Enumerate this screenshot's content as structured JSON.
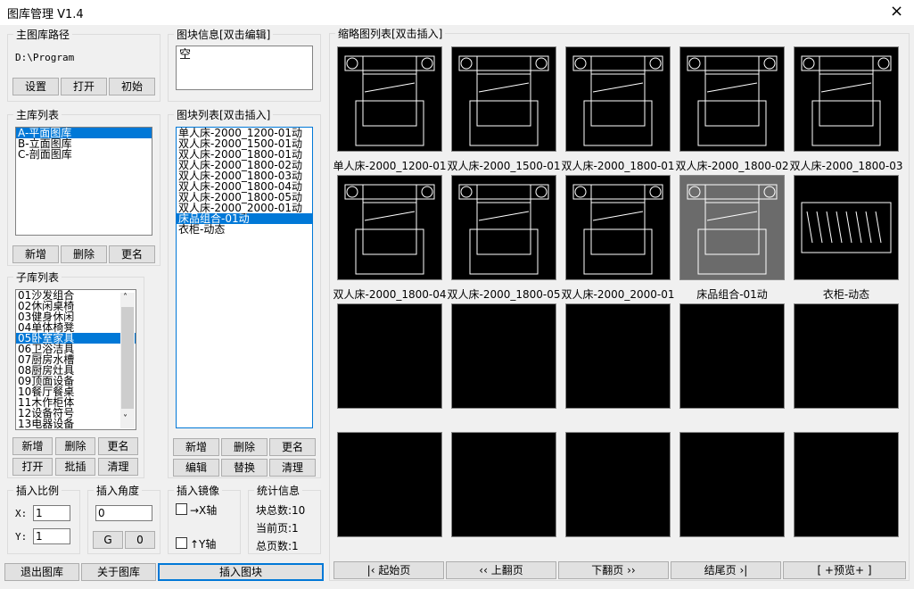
{
  "window": {
    "title": "图库管理 V1.4",
    "close_icon": "×"
  },
  "main_path": {
    "legend": "主图库路径",
    "path": "D:\\Program",
    "buttons": [
      "设置",
      "打开",
      "初始"
    ]
  },
  "block_info": {
    "legend": "图块信息[双击编辑]",
    "value": "空"
  },
  "main_lib": {
    "legend": "主库列表",
    "items": [
      "A-平面图库",
      "B-立面图库",
      "C-剖面图库"
    ],
    "selected": 0,
    "buttons": [
      "新增",
      "删除",
      "更名"
    ]
  },
  "block_list": {
    "legend": "图块列表[双击插入]",
    "items": [
      "单人床-2000_1200-01动",
      "双人床-2000_1500-01动",
      "双人床-2000_1800-01动",
      "双人床-2000_1800-02动",
      "双人床-2000_1800-03动",
      "双人床-2000_1800-04动",
      "双人床-2000_1800-05动",
      "双人床-2000_2000-01动",
      "床品组合-01动",
      "衣柜-动态"
    ],
    "selected": 8,
    "buttons": [
      "新增",
      "删除",
      "更名",
      "编辑",
      "替换",
      "清理"
    ]
  },
  "sub_lib": {
    "legend": "子库列表",
    "items": [
      "01沙发组合",
      "02休闲桌椅",
      "03健身休闲",
      "04单体椅凳",
      "05卧室家具",
      "06卫浴洁具",
      "07厨房水槽",
      "08厨房灶具",
      "09顶面设备",
      "10餐厅餐桌",
      "11木作柜体",
      "12设备符号",
      "13电器设备"
    ],
    "selected": 4,
    "buttons": [
      "新增",
      "删除",
      "更名",
      "打开",
      "批插",
      "清理"
    ],
    "scroll_up": "˄",
    "scroll_down": "˅"
  },
  "scale": {
    "legend": "插入比例",
    "x_label": "X:",
    "x": "1",
    "y_label": "Y:",
    "y": "1"
  },
  "angle": {
    "legend": "插入角度",
    "value": "0",
    "buttons": [
      "G",
      "0"
    ]
  },
  "mirror": {
    "legend": "插入镜像",
    "x_label": "→X轴",
    "y_label": "↑Y轴",
    "x_checked": false,
    "y_checked": false
  },
  "stats": {
    "legend": "统计信息",
    "total": "块总数:10",
    "current": "当前页:1",
    "pages": "总页数:1"
  },
  "bottom": {
    "exit": "退出图库",
    "about": "关于图库",
    "insert": "插入图块"
  },
  "thumbs": {
    "legend": "缩略图列表[双击插入]",
    "labels": [
      "单人床-2000_1200-01",
      "双人床-2000_1500-01",
      "双人床-2000_1800-01",
      "双人床-2000_1800-02",
      "双人床-2000_1800-03",
      "双人床-2000_1800-04",
      "双人床-2000_1800-05",
      "双人床-2000_2000-01",
      "床品组合-01动",
      "衣柜-动态"
    ]
  },
  "pager": [
    "|‹ 起始页",
    "‹‹ 上翻页",
    "下翻页 ››",
    "结尾页 ›|",
    "[ +预览+ ]"
  ]
}
